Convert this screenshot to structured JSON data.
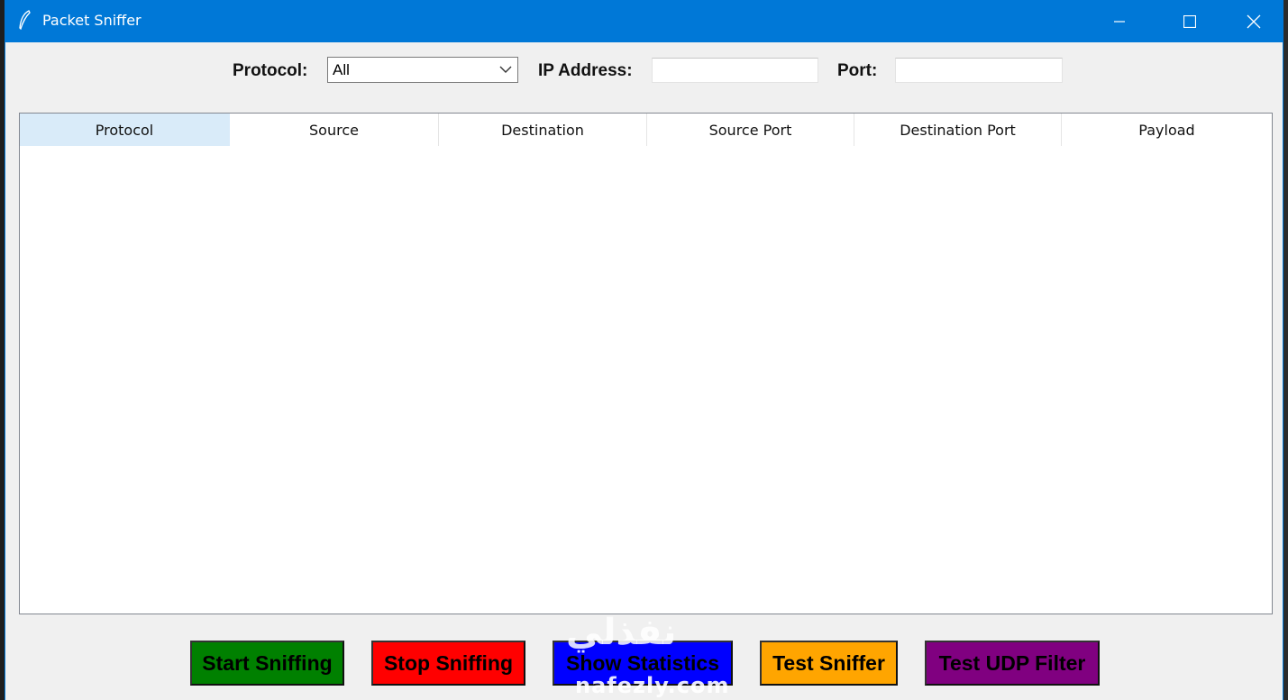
{
  "window": {
    "title": "Packet Sniffer",
    "titlebar_color": "#0078d7"
  },
  "filters": {
    "protocol_label": "Protocol:",
    "protocol_value": "All",
    "ip_label": "IP Address:",
    "ip_value": "",
    "port_label": "Port:",
    "port_value": ""
  },
  "table": {
    "columns": [
      "Protocol",
      "Source",
      "Destination",
      "Source Port",
      "Destination Port",
      "Payload"
    ],
    "rows": []
  },
  "buttons": [
    {
      "label": "Start Sniffing",
      "color": "#008000"
    },
    {
      "label": "Stop Sniffing",
      "color": "#ff0000"
    },
    {
      "label": "Show Statistics",
      "color": "#0000ff"
    },
    {
      "label": "Test Sniffer",
      "color": "#ffa500"
    },
    {
      "label": "Test UDP Filter",
      "color": "#800080"
    }
  ],
  "watermark": {
    "top": "نفذلي",
    "bottom": "nafezly.com"
  }
}
